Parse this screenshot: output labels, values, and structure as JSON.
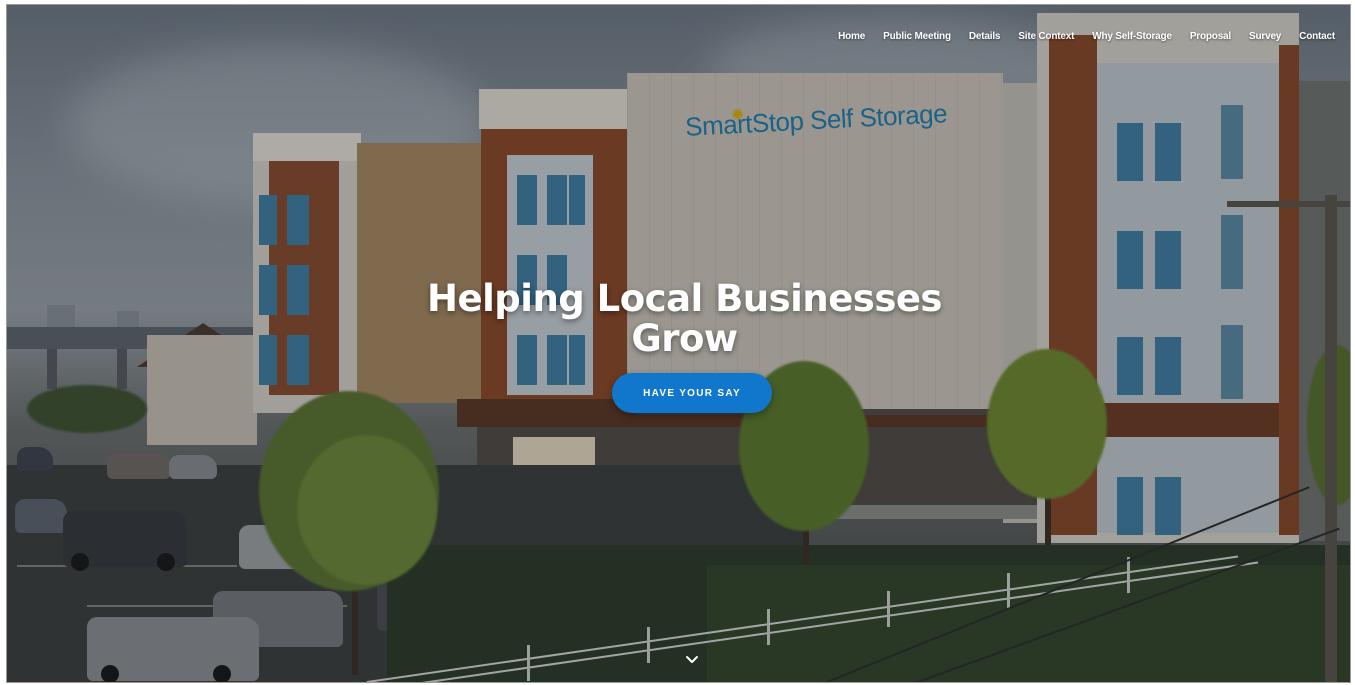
{
  "nav": {
    "items": [
      {
        "label": "Home"
      },
      {
        "label": "Public Meeting"
      },
      {
        "label": "Details"
      },
      {
        "label": "Site Context"
      },
      {
        "label": "Why Self-Storage"
      },
      {
        "label": "Proposal"
      },
      {
        "label": "Survey"
      },
      {
        "label": "Contact"
      }
    ]
  },
  "hero": {
    "title": "Helping Local Businesses Grow",
    "cta_label": "HAVE YOUR SAY",
    "building_sign": "SmartStop Self Storage",
    "scroll_icon": "chevron-down-icon"
  },
  "colors": {
    "accent": "#1177cc",
    "nav_text": "#ffffff",
    "sign_text": "#1d7fb0"
  }
}
